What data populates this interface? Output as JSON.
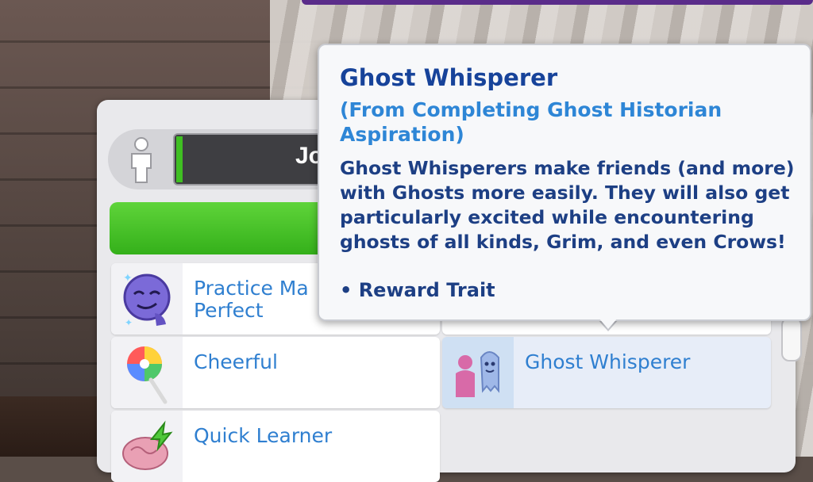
{
  "sim_panel": {
    "name_partial": "Jo"
  },
  "traits": [
    {
      "label": "Practice Ma\nPerfect",
      "icon": "practice-makes-perfect-icon"
    },
    {
      "label": "Cheerful",
      "icon": "lollipop-icon"
    },
    {
      "label": "Quick Learner",
      "icon": "brain-icon"
    },
    {
      "label": "Ghost Whisperer",
      "icon": "ghost-whisperer-icon",
      "selected": true
    }
  ],
  "tooltip": {
    "title": "Ghost Whisperer",
    "source": "(From Completing Ghost Historian Aspiration)",
    "description": "Ghost Whisperers make friends (and more) with Ghosts more easily. They will also get particularly excited while encountering ghosts of all kinds, Grim, and even Crows!",
    "tag": "• Reward Trait"
  },
  "colors": {
    "accent_green": "#34b01a",
    "title_blue": "#17439a",
    "label_blue": "#2f7fd0"
  }
}
